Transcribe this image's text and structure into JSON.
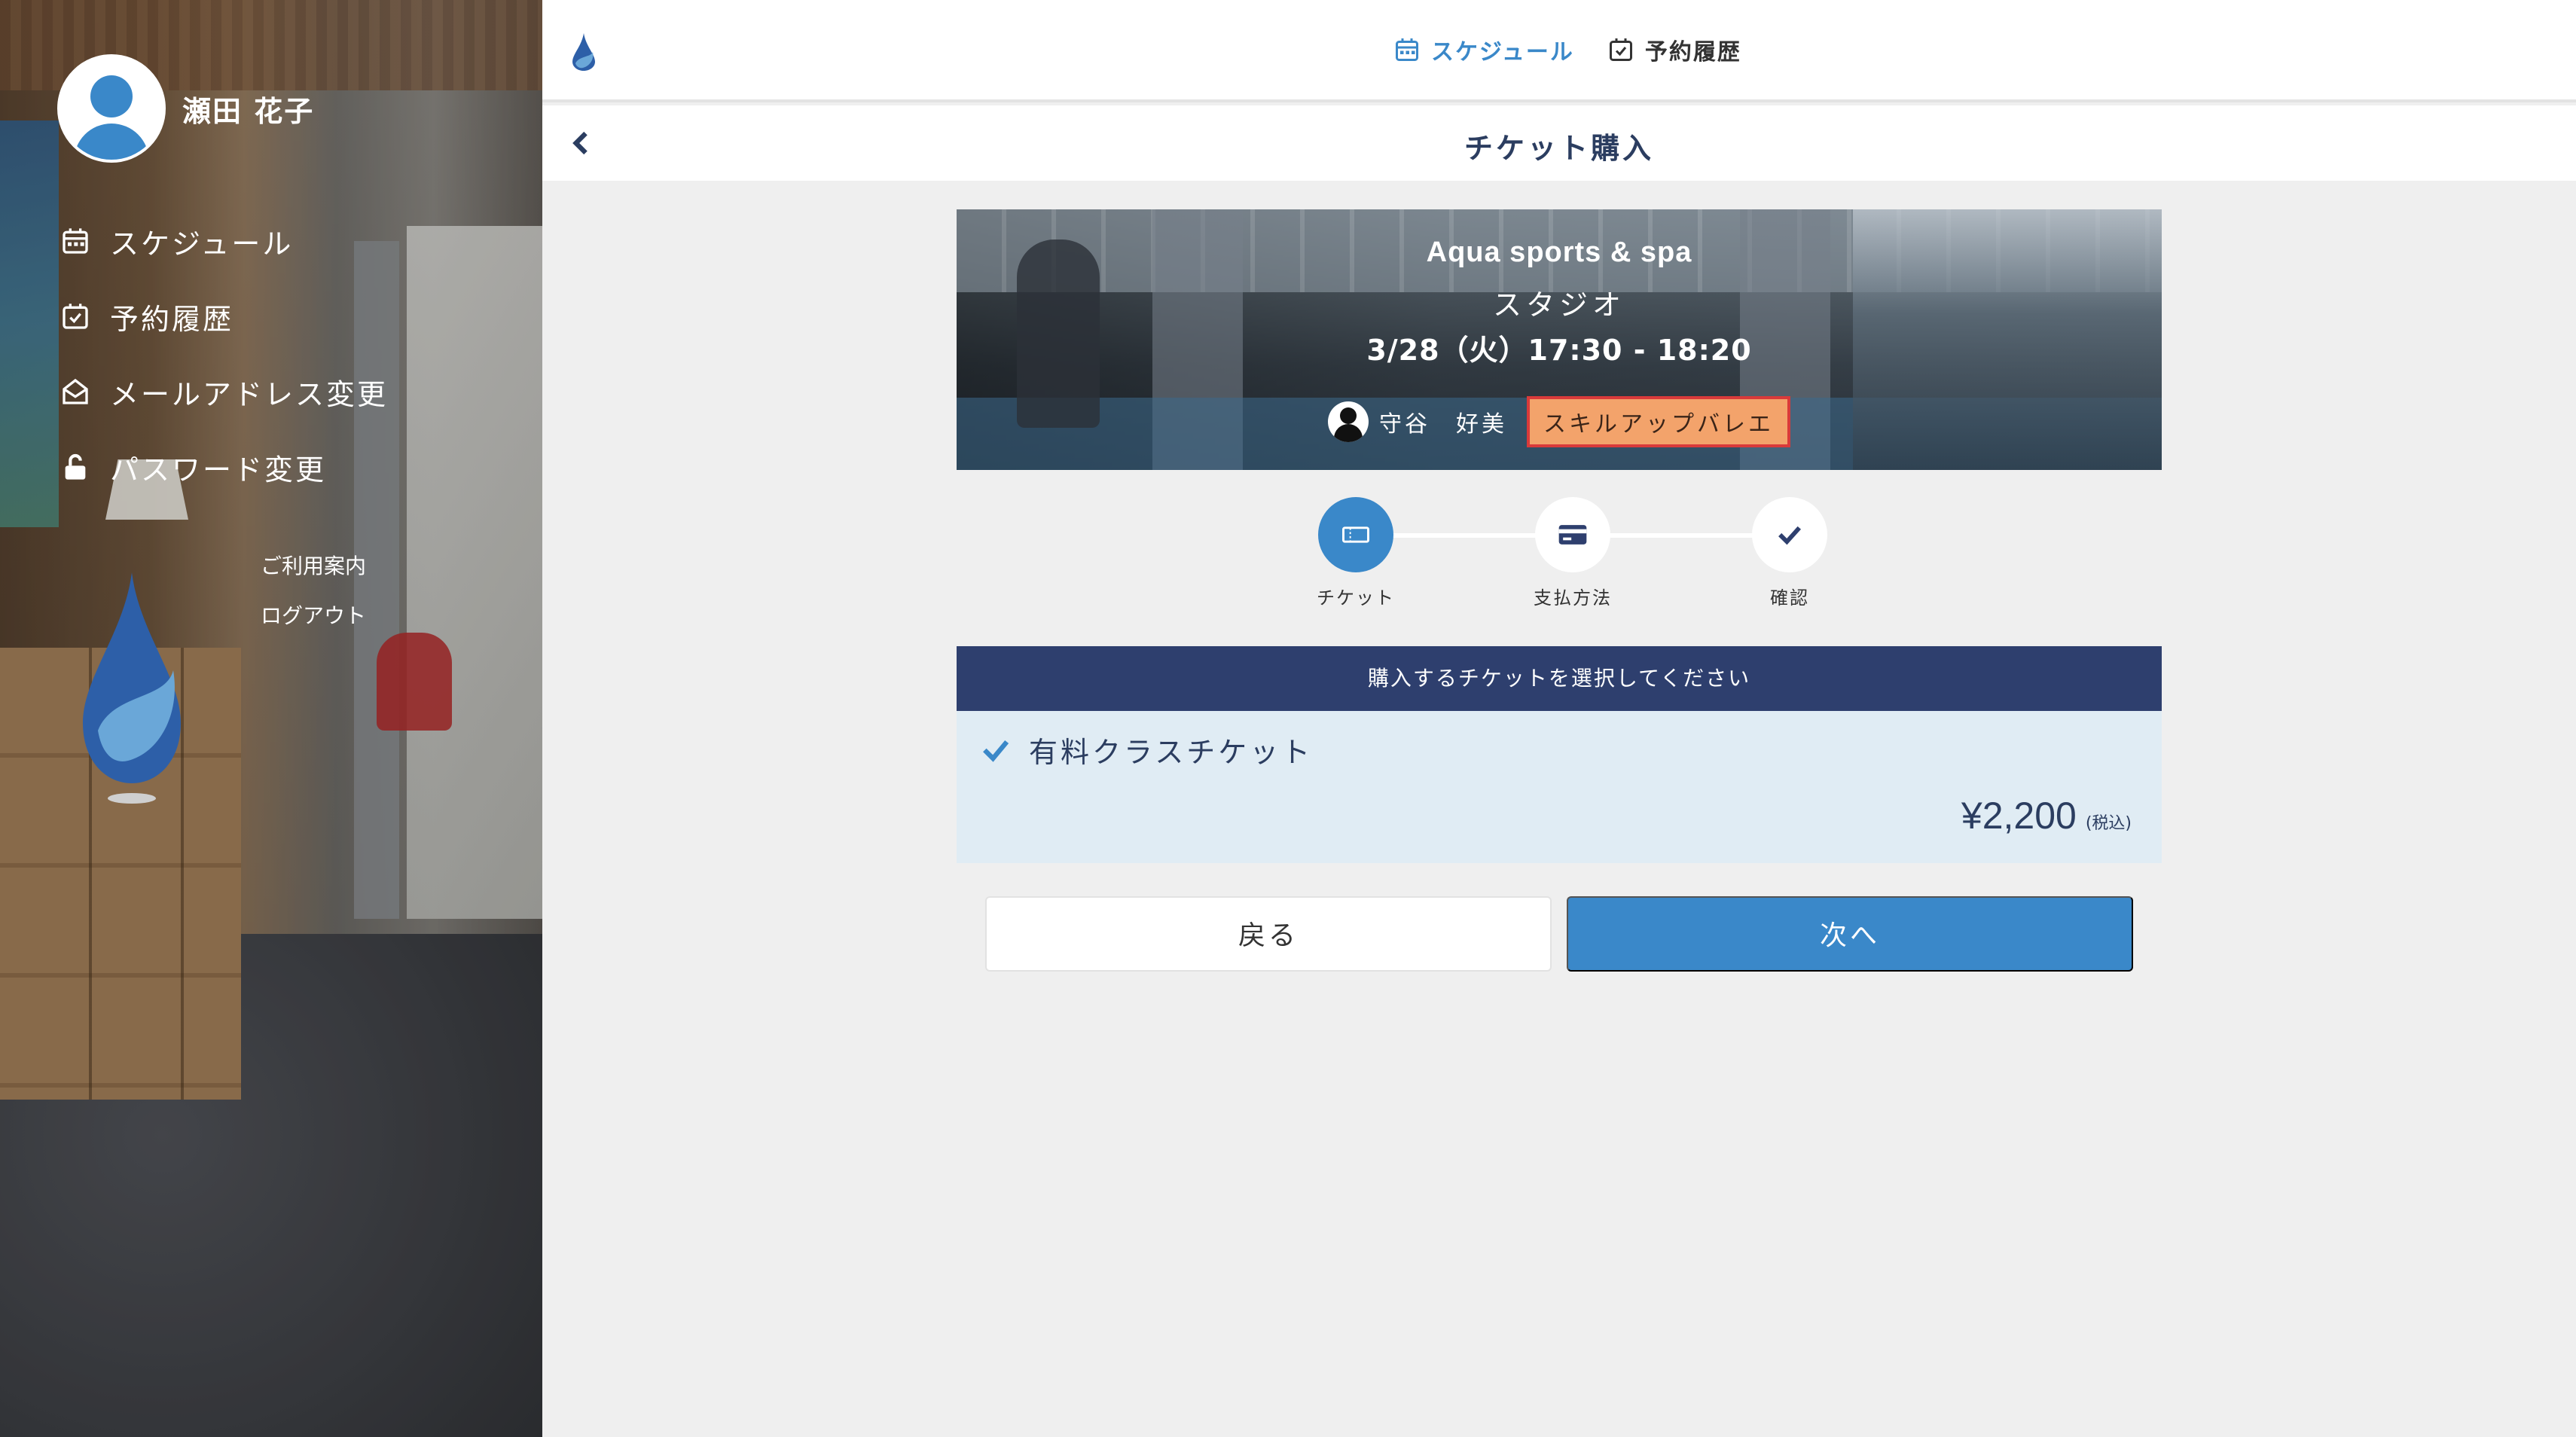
{
  "user": {
    "name": "瀬田 花子"
  },
  "sidebar": {
    "items": [
      {
        "label": "スケジュール",
        "icon": "calendar-icon"
      },
      {
        "label": "予約履歴",
        "icon": "calendar-check-icon"
      },
      {
        "label": "メールアドレス変更",
        "icon": "envelope-open-icon"
      },
      {
        "label": "パスワード変更",
        "icon": "unlock-icon"
      }
    ],
    "links": [
      "ご利用案内",
      "ログアウト"
    ]
  },
  "topnav": {
    "items": [
      {
        "label": "スケジュール",
        "icon": "calendar-icon",
        "active": true
      },
      {
        "label": "予約履歴",
        "icon": "calendar-check-icon",
        "active": false
      }
    ]
  },
  "page": {
    "title": "チケット購入"
  },
  "lesson": {
    "facility": "Aqua sports & spa",
    "room": "スタジオ",
    "datetime": "3/28（火）17:30 - 18:20",
    "instructor": "守谷　好美",
    "program": "スキルアップバレエ"
  },
  "steps": [
    {
      "label": "チケット",
      "icon": "ticket-icon",
      "active": true
    },
    {
      "label": "支払方法",
      "icon": "credit-card-icon",
      "active": false
    },
    {
      "label": "確認",
      "icon": "check-icon",
      "active": false
    }
  ],
  "ticket_panel": {
    "header": "購入するチケットを選択してください",
    "ticket": {
      "name": "有料クラスチケット",
      "price": "¥2,200",
      "tax_note": "(税込)",
      "selected": true
    }
  },
  "buttons": {
    "back": "戻る",
    "next": "次へ"
  },
  "colors": {
    "accent": "#3a88c9",
    "navy": "#2e3f6e",
    "tag_bg": "#f3a36b",
    "tag_border": "#d93a3a"
  }
}
